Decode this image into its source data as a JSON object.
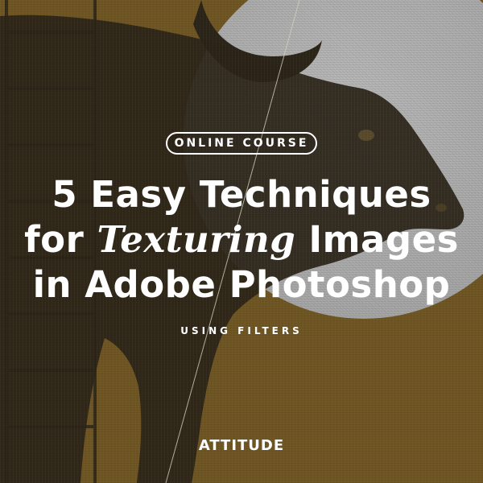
{
  "badge": {
    "label": "ONLINE COURSE"
  },
  "title": {
    "line1": "5 Easy Techniques",
    "line2_pre": "for ",
    "line2_italic": "Texturing",
    "line2_post": " Images",
    "line3": "in Adobe Photoshop"
  },
  "subtitle": "USING FILTERS",
  "brand": "ATTITUDE",
  "colors": {
    "background": "#6e5522",
    "moon": "#acacac",
    "bull": "#2b2418",
    "text": "#ffffff"
  }
}
